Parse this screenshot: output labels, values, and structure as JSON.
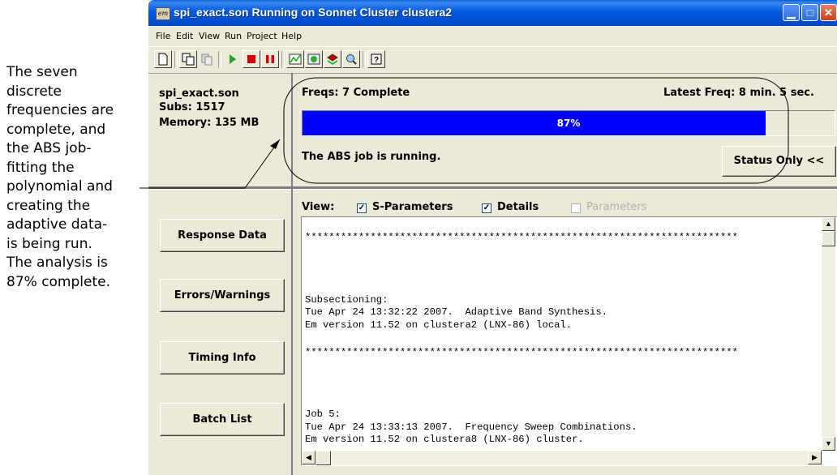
{
  "annotation": {
    "lines": [
      "The seven",
      "discrete",
      "frequencies are",
      "complete, and",
      "the ABS job-",
      "fitting the",
      "polynomial and",
      "creating the",
      "adaptive data-",
      "is being run.",
      "The analysis is",
      "87% complete."
    ]
  },
  "window": {
    "app_icon": "em",
    "title": "spi_exact.son   Running on Sonnet Cluster clustera2"
  },
  "menu": [
    "File",
    "Edit",
    "View",
    "Run",
    "Project",
    "Help"
  ],
  "toolbar_icons": [
    "new-icon",
    "copy-icon",
    "paste-icon",
    "play-icon",
    "stop-icon",
    "pause-icon",
    "chart-icon",
    "graph-icon",
    "layers-icon",
    "magnify-icon",
    "help-icon"
  ],
  "project": {
    "name": "spi_exact.son",
    "subs": "Subs: 1517",
    "memory": "Memory: 135 MB"
  },
  "status": {
    "freqs": "Freqs:  7 Complete",
    "latest_freq": "Latest Freq:  8 min. 5 sec.",
    "progress_percent": 87,
    "progress_label": "87%",
    "job_message": "The ABS job is running.",
    "status_button": "Status Only <<"
  },
  "side_buttons": [
    "Response Data",
    "Errors/Warnings",
    "Timing Info",
    "Batch List"
  ],
  "view": {
    "label": "View:",
    "options": [
      {
        "label": "S-Parameters",
        "checked": true,
        "enabled": true
      },
      {
        "label": "Details",
        "checked": true,
        "enabled": true
      },
      {
        "label": "Parameters",
        "checked": false,
        "enabled": false
      }
    ]
  },
  "log": [
    "",
    "*************************************************************************",
    "",
    "",
    "",
    "",
    "Subsectioning:",
    "Tue Apr 24 13:32:22 2007.  Adaptive Band Synthesis.",
    "Em version 11.52 on clustera2 (LNX-86) local.",
    "",
    "*************************************************************************",
    "",
    "",
    "",
    "",
    "Job 5:",
    "Tue Apr 24 13:33:13 2007.  Frequency Sweep Combinations.",
    "Em version 11.52 on clustera8 (LNX-86) cluster."
  ],
  "colors": {
    "progress": "#0000ff",
    "titlebar": "#0058e0",
    "face": "#ece9d8"
  }
}
